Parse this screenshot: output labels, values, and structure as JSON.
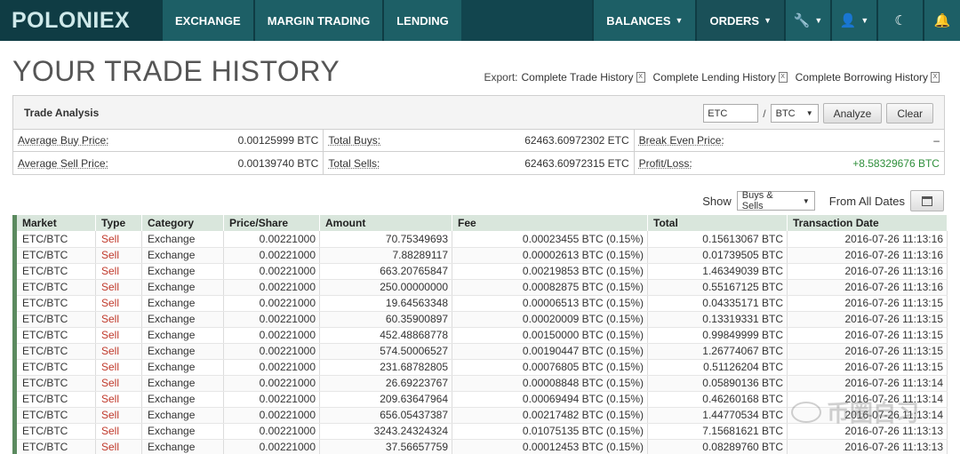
{
  "nav": {
    "logo": "POLONIEX",
    "items": [
      "EXCHANGE",
      "MARGIN TRADING",
      "LENDING"
    ],
    "right_items": [
      "BALANCES",
      "ORDERS"
    ],
    "icons": [
      "wrench-icon",
      "user-icon",
      "moon-icon",
      "bell-icon"
    ]
  },
  "page": {
    "title": "YOUR TRADE HISTORY",
    "export_label": "Export:",
    "export_links": [
      "Complete Trade History",
      "Complete Lending History",
      "Complete Borrowing History"
    ]
  },
  "analysis": {
    "title": "Trade Analysis",
    "currency_value": "ETC",
    "base_select": "BTC",
    "analyze_label": "Analyze",
    "clear_label": "Clear",
    "avg_buy_label": "Average Buy Price:",
    "avg_buy_value": "0.00125999 BTC",
    "total_buys_label": "Total Buys:",
    "total_buys_value": "62463.60972302 ETC",
    "break_even_label": "Break Even Price:",
    "break_even_value": "–",
    "avg_sell_label": "Average Sell Price:",
    "avg_sell_value": "0.00139740 BTC",
    "total_sells_label": "Total Sells:",
    "total_sells_value": "62463.60972315 ETC",
    "pl_label": "Profit/Loss:",
    "pl_value": "+8.58329676 BTC",
    "pl_color": "#2f8f3b"
  },
  "filter": {
    "show_label": "Show",
    "show_value": "Buys & Sells",
    "dates_label": "From All Dates"
  },
  "table": {
    "headers": [
      "Market",
      "Type",
      "Category",
      "Price/Share",
      "Amount",
      "Fee",
      "Total",
      "Transaction Date"
    ],
    "rows": [
      [
        "ETC/BTC",
        "Sell",
        "Exchange",
        "0.00221000",
        "70.75349693",
        "0.00023455 BTC (0.15%)",
        "0.15613067 BTC",
        "2016-07-26 11:13:16"
      ],
      [
        "ETC/BTC",
        "Sell",
        "Exchange",
        "0.00221000",
        "7.88289117",
        "0.00002613 BTC (0.15%)",
        "0.01739505 BTC",
        "2016-07-26 11:13:16"
      ],
      [
        "ETC/BTC",
        "Sell",
        "Exchange",
        "0.00221000",
        "663.20765847",
        "0.00219853 BTC (0.15%)",
        "1.46349039 BTC",
        "2016-07-26 11:13:16"
      ],
      [
        "ETC/BTC",
        "Sell",
        "Exchange",
        "0.00221000",
        "250.00000000",
        "0.00082875 BTC (0.15%)",
        "0.55167125 BTC",
        "2016-07-26 11:13:16"
      ],
      [
        "ETC/BTC",
        "Sell",
        "Exchange",
        "0.00221000",
        "19.64563348",
        "0.00006513 BTC (0.15%)",
        "0.04335171 BTC",
        "2016-07-26 11:13:15"
      ],
      [
        "ETC/BTC",
        "Sell",
        "Exchange",
        "0.00221000",
        "60.35900897",
        "0.00020009 BTC (0.15%)",
        "0.13319331 BTC",
        "2016-07-26 11:13:15"
      ],
      [
        "ETC/BTC",
        "Sell",
        "Exchange",
        "0.00221000",
        "452.48868778",
        "0.00150000 BTC (0.15%)",
        "0.99849999 BTC",
        "2016-07-26 11:13:15"
      ],
      [
        "ETC/BTC",
        "Sell",
        "Exchange",
        "0.00221000",
        "574.50006527",
        "0.00190447 BTC (0.15%)",
        "1.26774067 BTC",
        "2016-07-26 11:13:15"
      ],
      [
        "ETC/BTC",
        "Sell",
        "Exchange",
        "0.00221000",
        "231.68782805",
        "0.00076805 BTC (0.15%)",
        "0.51126204 BTC",
        "2016-07-26 11:13:15"
      ],
      [
        "ETC/BTC",
        "Sell",
        "Exchange",
        "0.00221000",
        "26.69223767",
        "0.00008848 BTC (0.15%)",
        "0.05890136 BTC",
        "2016-07-26 11:13:14"
      ],
      [
        "ETC/BTC",
        "Sell",
        "Exchange",
        "0.00221000",
        "209.63647964",
        "0.00069494 BTC (0.15%)",
        "0.46260168 BTC",
        "2016-07-26 11:13:14"
      ],
      [
        "ETC/BTC",
        "Sell",
        "Exchange",
        "0.00221000",
        "656.05437387",
        "0.00217482 BTC (0.15%)",
        "1.44770534 BTC",
        "2016-07-26 11:13:14"
      ],
      [
        "ETC/BTC",
        "Sell",
        "Exchange",
        "0.00221000",
        "3243.24324324",
        "0.01075135 BTC (0.15%)",
        "7.15681621 BTC",
        "2016-07-26 11:13:13"
      ],
      [
        "ETC/BTC",
        "Sell",
        "Exchange",
        "0.00221000",
        "37.56657759",
        "0.00012453 BTC (0.15%)",
        "0.08289760 BTC",
        "2016-07-26 11:13:13"
      ]
    ]
  },
  "watermark": "币圈自习"
}
